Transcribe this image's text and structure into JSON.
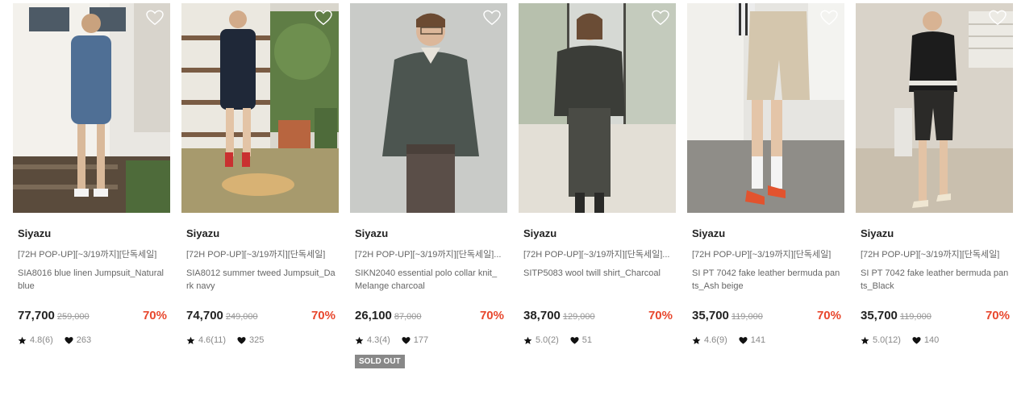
{
  "products": [
    {
      "brand": "Siyazu",
      "promo": "[72H POP-UP][~3/19까지][단독세일]",
      "name": "SIA8016 blue linen Jumpsuit_Natural blue",
      "price": "77,700",
      "original_price": "259,000",
      "discount": "70%",
      "rating": "4.8(6)",
      "likes": "263",
      "sold_out": null,
      "wish_icon": "heart-outline-icon"
    },
    {
      "brand": "Siyazu",
      "promo": "[72H POP-UP][~3/19까지][단독세일]",
      "name": "SIA8012 summer tweed Jumpsuit_Dark navy",
      "price": "74,700",
      "original_price": "249,000",
      "discount": "70%",
      "rating": "4.6(11)",
      "likes": "325",
      "sold_out": null,
      "wish_icon": "heart-outline-icon"
    },
    {
      "brand": "Siyazu",
      "promo": "[72H POP-UP][~3/19까지][단독세일]...",
      "name": "SIKN2040 essential polo collar knit_Melange charcoal",
      "price": "26,100",
      "original_price": "87,000",
      "discount": "70%",
      "rating": "4.3(4)",
      "likes": "177",
      "sold_out": "SOLD OUT",
      "wish_icon": "heart-outline-icon"
    },
    {
      "brand": "Siyazu",
      "promo": "[72H POP-UP][~3/19까지][단독세일]...",
      "name": "SITP5083 wool twill shirt_Charcoal",
      "price": "38,700",
      "original_price": "129,000",
      "discount": "70%",
      "rating": "5.0(2)",
      "likes": "51",
      "sold_out": null,
      "wish_icon": "heart-outline-icon"
    },
    {
      "brand": "Siyazu",
      "promo": "[72H POP-UP][~3/19까지][단독세일]",
      "name": "SI PT 7042 fake leather bermuda pants_Ash beige",
      "price": "35,700",
      "original_price": "119,000",
      "discount": "70%",
      "rating": "4.6(9)",
      "likes": "141",
      "sold_out": null,
      "wish_icon": "heart-outline-icon"
    },
    {
      "brand": "Siyazu",
      "promo": "[72H POP-UP][~3/19까지][단독세일]",
      "name": "SI PT 7042 fake leather bermuda pants_Black",
      "price": "35,700",
      "original_price": "119,000",
      "discount": "70%",
      "rating": "5.0(12)",
      "likes": "140",
      "sold_out": null,
      "wish_icon": "heart-outline-icon"
    }
  ],
  "colors": {
    "discount": "#e8472d",
    "sold_out_bg": "#888888",
    "text_primary": "#222222",
    "text_secondary": "#666666"
  }
}
